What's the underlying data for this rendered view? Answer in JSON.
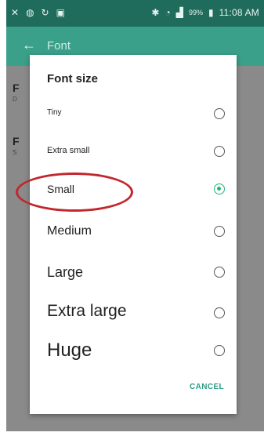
{
  "status_bar": {
    "left_icons": [
      "notification-icon",
      "voicemail-icon",
      "sync-icon",
      "image-icon"
    ],
    "right_icons": [
      "bluetooth-icon",
      "wifi-icon",
      "signal-icon"
    ],
    "battery": "99%",
    "time": "11:08 AM"
  },
  "app_bar": {
    "title": "Font",
    "back_icon": "arrow-left-icon"
  },
  "background_rows": [
    {
      "label": "F",
      "sub": "D"
    },
    {
      "label": "F",
      "sub": "S"
    }
  ],
  "dialog": {
    "title": "Font size",
    "options": [
      {
        "label": "Tiny",
        "selected": false
      },
      {
        "label": "Extra small",
        "selected": false
      },
      {
        "label": "Small",
        "selected": true
      },
      {
        "label": "Medium",
        "selected": false
      },
      {
        "label": "Large",
        "selected": false
      },
      {
        "label": "Extra large",
        "selected": false
      },
      {
        "label": "Huge",
        "selected": false
      }
    ],
    "cancel_label": "CANCEL"
  },
  "colors": {
    "status_bar": "#1f6b5c",
    "app_bar": "#3aa08a",
    "radio_selected": "#22b573",
    "annotation": "#c1272d"
  }
}
